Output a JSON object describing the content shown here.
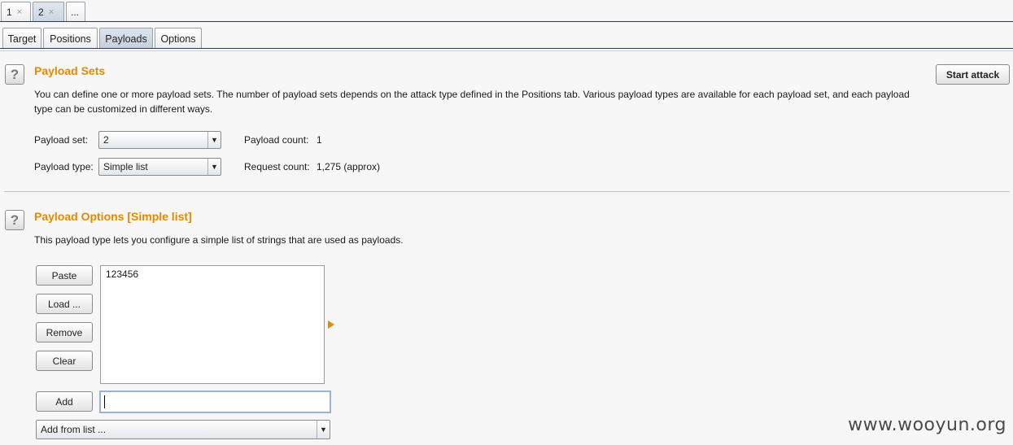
{
  "top_tabs": [
    {
      "label": "1",
      "close": "×"
    },
    {
      "label": "2",
      "close": "×"
    },
    {
      "label": "..."
    }
  ],
  "sub_tabs": [
    "Target",
    "Positions",
    "Payloads",
    "Options"
  ],
  "payload_sets": {
    "help": "?",
    "title": "Payload Sets",
    "description_line1": "You can define one or more payload sets. The number of payload sets depends on the attack type defined in the Positions tab. Various payload types are available for each payload set, and each payload",
    "description_line2": "type can be customized in different ways.",
    "start_attack": "Start attack",
    "payload_set_label": "Payload set:",
    "payload_set_value": "2",
    "payload_type_label": "Payload type:",
    "payload_type_value": "Simple list",
    "payload_count_label": "Payload count:",
    "payload_count_value": "1",
    "request_count_label": "Request count:",
    "request_count_value": "1,275 (approx)"
  },
  "payload_options": {
    "help": "?",
    "title": "Payload Options [Simple list]",
    "description": "This payload type lets you configure a simple list of strings that are used as payloads.",
    "buttons": {
      "paste": "Paste",
      "load": "Load ...",
      "remove": "Remove",
      "clear": "Clear",
      "add": "Add"
    },
    "list_items": [
      "123456"
    ],
    "add_input_value": "",
    "add_from_list": "Add from list ..."
  },
  "watermark": "www.wooyun.org",
  "colors": {
    "section_title": "#e58a00",
    "tab_line": "#2d3a57"
  }
}
